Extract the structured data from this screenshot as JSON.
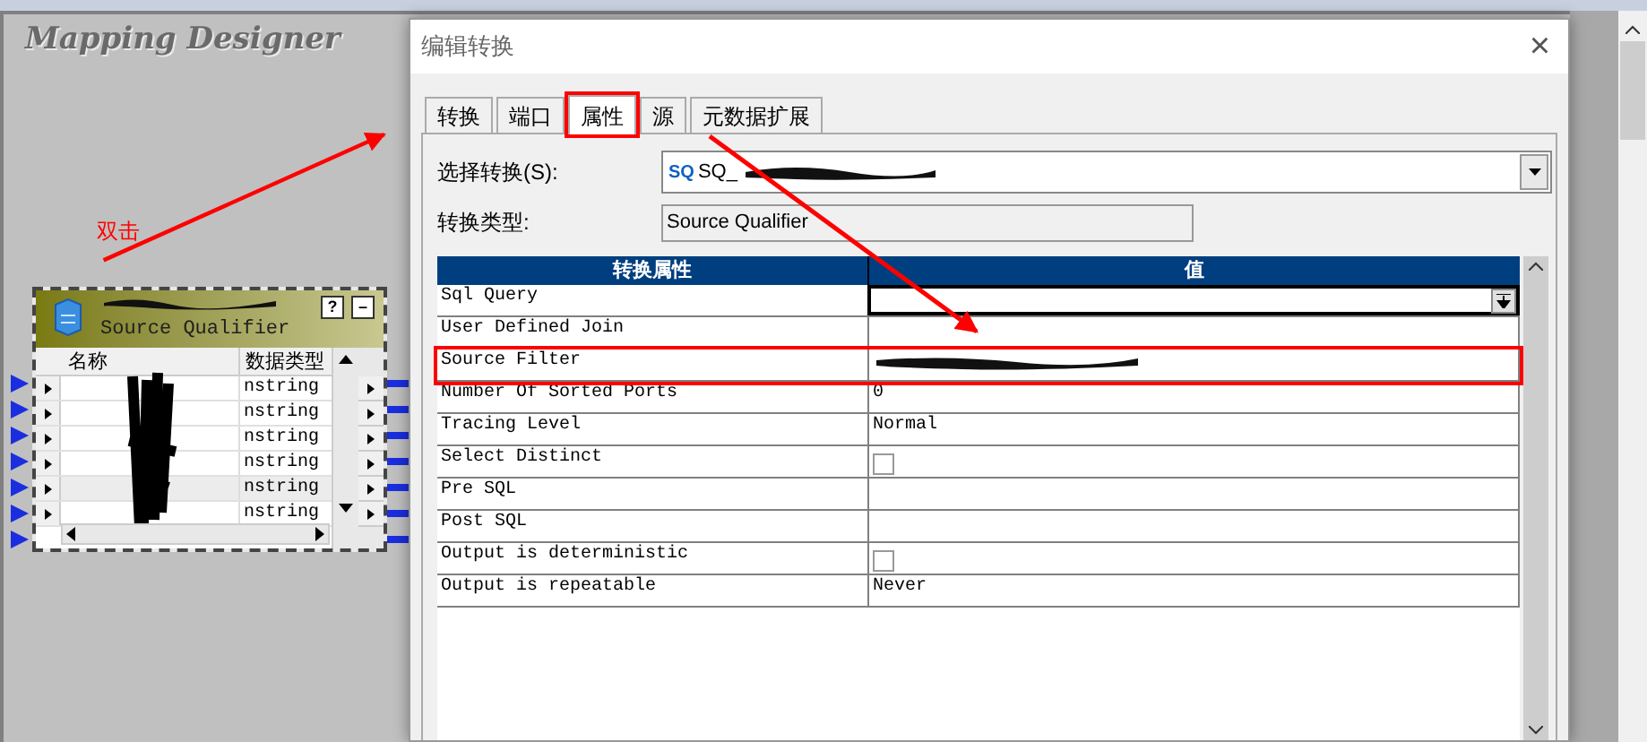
{
  "app": {
    "title": "Mapping Designer"
  },
  "annotation": {
    "label": "双击"
  },
  "node": {
    "title": "Source Qualifier",
    "help": "?",
    "minimize": "–",
    "columns": [
      "名称",
      "数据类型"
    ],
    "ports": [
      {
        "type": "nstring",
        "selected": false
      },
      {
        "type": "nstring",
        "selected": false
      },
      {
        "type": "nstring",
        "selected": false
      },
      {
        "type": "nstring",
        "selected": false
      },
      {
        "type": "nstring",
        "selected": true
      },
      {
        "type": "nstring",
        "selected": false
      }
    ]
  },
  "dialog": {
    "title": "编辑转换",
    "close": "×",
    "tabs": [
      {
        "label": "转换",
        "selected": false,
        "highlighted": false
      },
      {
        "label": "端口",
        "selected": false,
        "highlighted": false
      },
      {
        "label": "属性",
        "selected": true,
        "highlighted": true
      },
      {
        "label": "源",
        "selected": false,
        "highlighted": false
      },
      {
        "label": "元数据扩展",
        "selected": false,
        "highlighted": false
      }
    ],
    "select_label": "选择转换(S):",
    "select_icon": "SQ",
    "select_value": "SQ_",
    "type_label": "转换类型:",
    "type_value": "Source Qualifier",
    "table": {
      "columns": [
        "转换属性",
        "值"
      ],
      "rows": [
        {
          "name": "Sql Query",
          "kind": "editor",
          "highlighted": false
        },
        {
          "name": "User Defined Join",
          "kind": "text",
          "highlighted": false
        },
        {
          "name": "Source Filter",
          "kind": "redacted",
          "highlighted": true
        },
        {
          "name": "Number Of Sorted Ports",
          "kind": "text",
          "value": "0",
          "highlighted": false
        },
        {
          "name": "Tracing Level",
          "kind": "text",
          "value": "Normal",
          "highlighted": false
        },
        {
          "name": "Select Distinct",
          "kind": "checkbox",
          "checked": false,
          "highlighted": false
        },
        {
          "name": "Pre SQL",
          "kind": "text",
          "highlighted": false
        },
        {
          "name": "Post SQL",
          "kind": "text",
          "highlighted": false
        },
        {
          "name": "Output is deterministic",
          "kind": "checkbox",
          "checked": false,
          "highlighted": false
        },
        {
          "name": "Output is repeatable",
          "kind": "text",
          "value": "Never",
          "highlighted": false
        }
      ]
    }
  }
}
